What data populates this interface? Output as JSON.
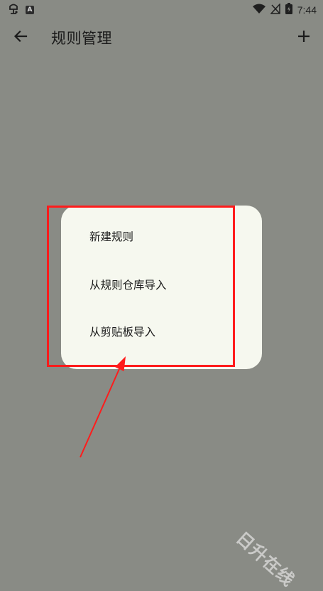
{
  "status_bar": {
    "left_icons": [
      "app-notification-icon",
      "a-badge-icon"
    ],
    "a_badge_text": "A",
    "right_icons": [
      "wifi-icon",
      "no-signal-icon",
      "battery-icon"
    ],
    "time": "7:44"
  },
  "app_bar": {
    "back_icon": "arrow-left-icon",
    "title": "规则管理",
    "add_icon": "plus-icon"
  },
  "popup_menu": {
    "items": [
      {
        "label": "新建规则"
      },
      {
        "label": "从规则仓库导入"
      },
      {
        "label": "从剪贴板导入"
      }
    ]
  },
  "annotation": {
    "highlight_color": "#ff1c1c",
    "arrow_color": "#ff1c1c"
  },
  "colors": {
    "background": "#898b85",
    "menu_background": "#f6f8ef"
  },
  "watermark": {
    "text": "日升在线"
  }
}
